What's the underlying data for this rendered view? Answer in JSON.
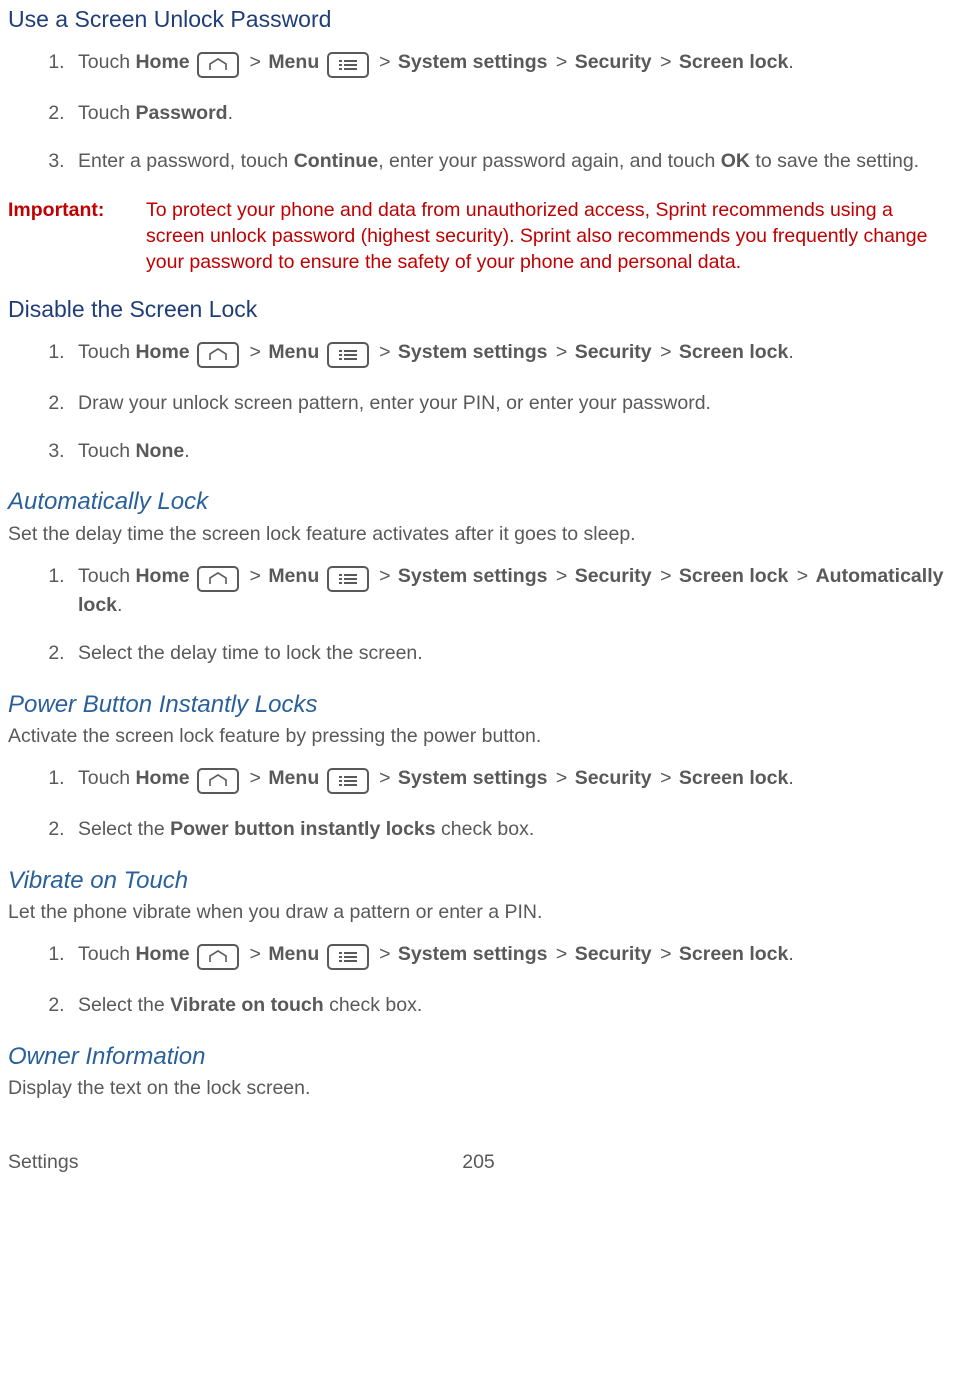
{
  "labels": {
    "touch": "Touch",
    "home": "Home",
    "menu": "Menu",
    "system_settings": "System settings",
    "security": "Security",
    "screen_lock": "Screen lock",
    "password": "Password",
    "continue": "Continue",
    "ok": "OK",
    "none": "None",
    "auto_lock": "Automatically lock",
    "pbil": "Power button instantly locks",
    "vot": "Vibrate on touch",
    "select_the": "Select the",
    "check_box": "check box."
  },
  "sections": {
    "use_password": {
      "title": "Use a Screen Unlock Password",
      "step3": "Enter a password, touch ",
      "step3b": ", enter your password again, and touch ",
      "step3c": " to save the setting."
    },
    "important": {
      "label": "Important:",
      "text": "To protect your phone and data from unauthorized access, Sprint recommends using a screen unlock password (highest security). Sprint also recommends you frequently change your password to ensure the safety of your phone and personal data."
    },
    "disable": {
      "title": "Disable the Screen Lock",
      "step2": "Draw your unlock screen pattern, enter your PIN, or enter your password."
    },
    "autolock": {
      "title": "Automatically Lock",
      "desc": "Set the delay time the screen lock feature activates after it goes to sleep.",
      "step2": "Select the delay time to lock the screen."
    },
    "pbil": {
      "title": "Power Button Instantly Locks",
      "desc": "Activate the screen lock feature by pressing the power button."
    },
    "vot": {
      "title": "Vibrate on Touch",
      "desc": "Let the phone vibrate when you draw a pattern or enter a PIN."
    },
    "owner": {
      "title": "Owner Information",
      "desc": "Display the text on the lock screen."
    }
  },
  "footer": {
    "left": "Settings",
    "page": "205"
  },
  "breadcrumb_sep": ">"
}
